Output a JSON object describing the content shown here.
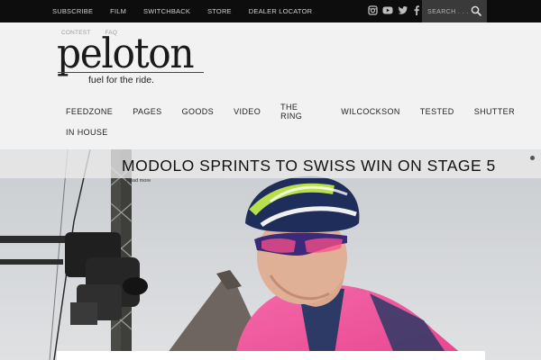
{
  "topbar": {
    "links": [
      "SUBSCRIBE",
      "FILM",
      "SWITCHBACK",
      "STORE",
      "DEALER LOCATOR"
    ],
    "social_icons": [
      "instagram-icon",
      "youtube-icon",
      "twitter-icon",
      "facebook-icon"
    ],
    "search_placeholder": "SEARCH . . ."
  },
  "header": {
    "sublinks": [
      "CONTEST",
      "FAQ"
    ],
    "logo": "peloton",
    "tagline": "fuel for the ride."
  },
  "mainnav": {
    "row1": [
      "FEEDZONE",
      "PAGES",
      "GOODS",
      "VIDEO",
      "THE RING",
      "WILCOCKSON",
      "TESTED",
      "SHUTTER"
    ],
    "row2": [
      "IN HOUSE"
    ]
  },
  "hero": {
    "title": "MODOLO SPRINTS TO SWISS WIN ON STAGE 5",
    "read_more": "Read more"
  },
  "colors": {
    "topbar_bg": "#0d0d0d",
    "search_bg": "#3a3a3a",
    "page_bg": "#f2f2f2",
    "jersey": "#f0559b",
    "helmet_accent": "#b9e04a"
  }
}
